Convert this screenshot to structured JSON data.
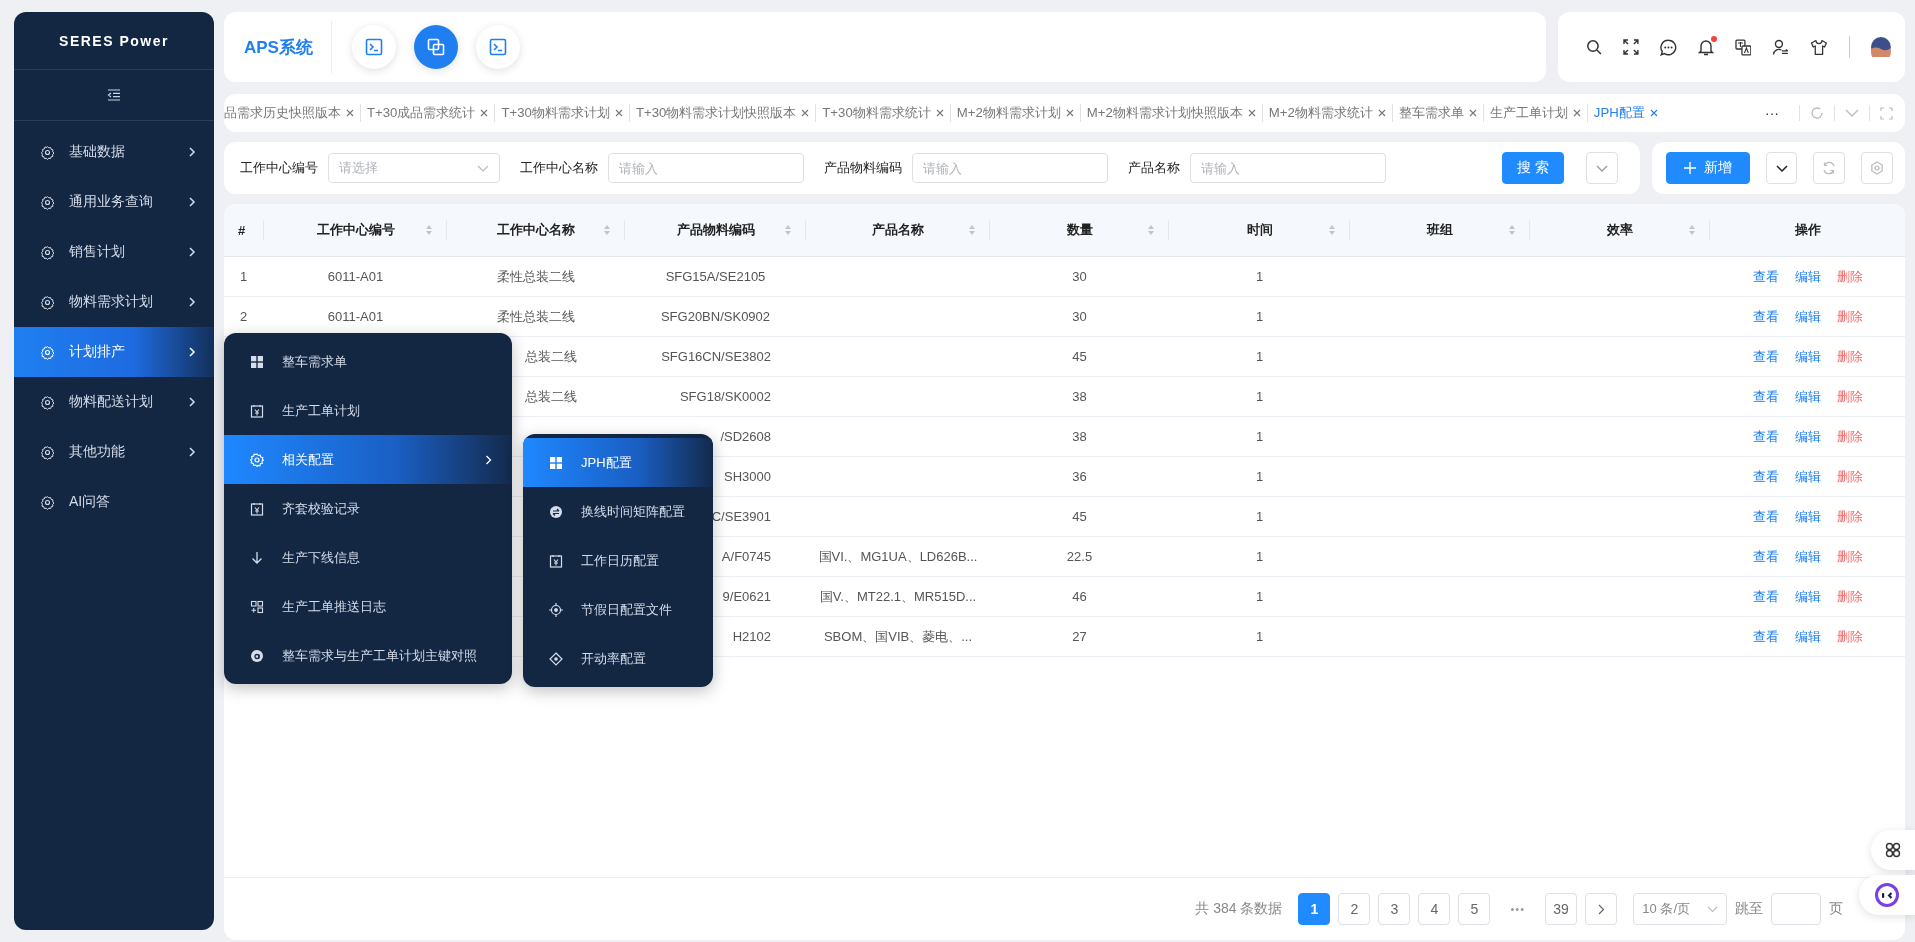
{
  "sidebar": {
    "logo": "SERES Power",
    "items": [
      {
        "label": "基础数据",
        "selected": false,
        "submenu": true
      },
      {
        "label": "通用业务查询",
        "selected": false,
        "submenu": true
      },
      {
        "label": "销售计划",
        "selected": false,
        "submenu": true
      },
      {
        "label": "物料需求计划",
        "selected": false,
        "submenu": true
      },
      {
        "label": "计划排产",
        "selected": true,
        "submenu": true
      },
      {
        "label": "物料配送计划",
        "selected": false,
        "submenu": true
      },
      {
        "label": "其他功能",
        "selected": false,
        "submenu": true
      },
      {
        "label": "AI问答",
        "selected": false,
        "submenu": false
      }
    ]
  },
  "header": {
    "title": "APS系统",
    "shortcuts": [
      {
        "kind": "terminal",
        "selected": false
      },
      {
        "kind": "copy",
        "selected": true
      },
      {
        "kind": "terminal",
        "selected": false
      }
    ],
    "bell_badge": true
  },
  "tabs": [
    {
      "label": "品需求历史快照版本",
      "selected": false
    },
    {
      "label": "T+30成品需求统计",
      "selected": false
    },
    {
      "label": "T+30物料需求计划",
      "selected": false
    },
    {
      "label": "T+30物料需求计划快照版本",
      "selected": false
    },
    {
      "label": "T+30物料需求统计",
      "selected": false
    },
    {
      "label": "M+2物料需求计划",
      "selected": false
    },
    {
      "label": "M+2物料需求计划快照版本",
      "selected": false
    },
    {
      "label": "M+2物料需求统计",
      "selected": false
    },
    {
      "label": "整车需求单",
      "selected": false
    },
    {
      "label": "生产工单计划",
      "selected": false
    },
    {
      "label": "JPH配置",
      "selected": true
    }
  ],
  "tabs_more": "···",
  "filters": [
    {
      "label": "工作中心编号",
      "placeholder": "请选择",
      "kind": "select"
    },
    {
      "label": "工作中心名称",
      "placeholder": "请输入",
      "kind": "input"
    },
    {
      "label": "产品物料编码",
      "placeholder": "请输入",
      "kind": "input"
    },
    {
      "label": "产品名称",
      "placeholder": "请输入",
      "kind": "input"
    }
  ],
  "search_button": "搜 索",
  "add_button": "新增",
  "table": {
    "columns": [
      {
        "label": "#",
        "sortable": false
      },
      {
        "label": "工作中心编号",
        "sortable": true
      },
      {
        "label": "工作中心名称",
        "sortable": true
      },
      {
        "label": "产品物料编码",
        "sortable": true
      },
      {
        "label": "产品名称",
        "sortable": true
      },
      {
        "label": "数量",
        "sortable": true
      },
      {
        "label": "时间",
        "sortable": true
      },
      {
        "label": "班组",
        "sortable": true
      },
      {
        "label": "效率",
        "sortable": true
      },
      {
        "label": "操作",
        "sortable": false
      }
    ],
    "rows": [
      {
        "covered": false,
        "index": "1",
        "center_code": "6011-A01",
        "center_name": "柔性总装二线",
        "material_code": "SFG15A/SE2105",
        "quantity": "30",
        "time": "1",
        "actions": [
          {
            "label": "查看",
            "kind": "link"
          },
          {
            "label": "编辑",
            "kind": "link"
          },
          {
            "label": "删除",
            "kind": "danger"
          }
        ]
      },
      {
        "covered": false,
        "index": "2",
        "center_code": "6011-A01",
        "center_name": "柔性总装二线",
        "material_code": "SFG20BN/SK0902",
        "quantity": "30",
        "time": "1",
        "actions": [
          {
            "label": "查看",
            "kind": "link"
          },
          {
            "label": "编辑",
            "kind": "link"
          },
          {
            "label": "删除",
            "kind": "danger"
          }
        ]
      },
      {
        "covered": true,
        "center_name": "总装二线",
        "material_code": "SFG16CN/SE3802",
        "quantity": "45",
        "time": "1",
        "actions": [
          {
            "label": "查看",
            "kind": "link"
          },
          {
            "label": "编辑",
            "kind": "link"
          },
          {
            "label": "删除",
            "kind": "danger"
          }
        ]
      },
      {
        "covered": true,
        "center_name": "总装二线",
        "material_code": "SFG18/SK0002",
        "quantity": "38",
        "time": "1",
        "actions": [
          {
            "label": "查看",
            "kind": "link"
          },
          {
            "label": "编辑",
            "kind": "link"
          },
          {
            "label": "删除",
            "kind": "danger"
          }
        ]
      },
      {
        "covered": true,
        "material_code": "/SD2608",
        "quantity": "38",
        "time": "1",
        "actions": [
          {
            "label": "查看",
            "kind": "link"
          },
          {
            "label": "编辑",
            "kind": "link"
          },
          {
            "label": "删除",
            "kind": "danger"
          }
        ]
      },
      {
        "covered": true,
        "material_code": "SH3000",
        "quantity": "36",
        "time": "1",
        "actions": [
          {
            "label": "查看",
            "kind": "link"
          },
          {
            "label": "编辑",
            "kind": "link"
          },
          {
            "label": "删除",
            "kind": "danger"
          }
        ]
      },
      {
        "covered": true,
        "material_code": "C/SE3901",
        "quantity": "45",
        "time": "1",
        "actions": [
          {
            "label": "查看",
            "kind": "link"
          },
          {
            "label": "编辑",
            "kind": "link"
          },
          {
            "label": "删除",
            "kind": "danger"
          }
        ]
      },
      {
        "covered": true,
        "material_code": "A/F0745",
        "product_name": "国VI.、MG1UA、LD626B...",
        "quantity": "22.5",
        "time": "1",
        "actions": [
          {
            "label": "查看",
            "kind": "link"
          },
          {
            "label": "编辑",
            "kind": "link"
          },
          {
            "label": "删除",
            "kind": "danger"
          }
        ]
      },
      {
        "covered": true,
        "material_code": "9/E0621",
        "product_name": "国V.、MT22.1、MR515D...",
        "quantity": "46",
        "time": "1",
        "actions": [
          {
            "label": "查看",
            "kind": "link"
          },
          {
            "label": "编辑",
            "kind": "link"
          },
          {
            "label": "删除",
            "kind": "danger"
          }
        ]
      },
      {
        "covered": true,
        "material_code": "H2102",
        "product_name": "SBOM、国VIB、菱电、...",
        "quantity": "27",
        "time": "1",
        "actions": [
          {
            "label": "查看",
            "kind": "link"
          },
          {
            "label": "编辑",
            "kind": "link"
          },
          {
            "label": "删除",
            "kind": "danger"
          }
        ]
      }
    ]
  },
  "pagination": {
    "total": "共 384 条数据",
    "pages": [
      {
        "label": "1",
        "selected": true
      },
      {
        "label": "2",
        "selected": false
      },
      {
        "label": "3",
        "selected": false
      },
      {
        "label": "4",
        "selected": false
      },
      {
        "label": "5",
        "selected": false
      }
    ],
    "ellipsis": "•••",
    "last_page": "39",
    "page_size": "10 条/页",
    "jump_label": "跳至",
    "page_unit": "页"
  },
  "flyout": {
    "items": [
      {
        "label": "整车需求单",
        "selected": false,
        "submenu": false
      },
      {
        "label": "生产工单计划",
        "selected": false,
        "submenu": false
      },
      {
        "label": "相关配置",
        "selected": true,
        "submenu": true
      },
      {
        "label": "齐套校验记录",
        "selected": false,
        "submenu": false
      },
      {
        "label": "生产下线信息",
        "selected": false,
        "submenu": false
      },
      {
        "label": "生产工单推送日志",
        "selected": false,
        "submenu": false
      },
      {
        "label": "整车需求与生产工单计划主键对照",
        "selected": false,
        "submenu": false
      }
    ],
    "sub_items": [
      {
        "label": "JPH配置",
        "selected": true
      },
      {
        "label": "换线时间矩阵配置",
        "selected": false
      },
      {
        "label": "工作日历配置",
        "selected": false
      },
      {
        "label": "节假日配置文件",
        "selected": false
      },
      {
        "label": "开动率配置",
        "selected": false
      }
    ]
  }
}
